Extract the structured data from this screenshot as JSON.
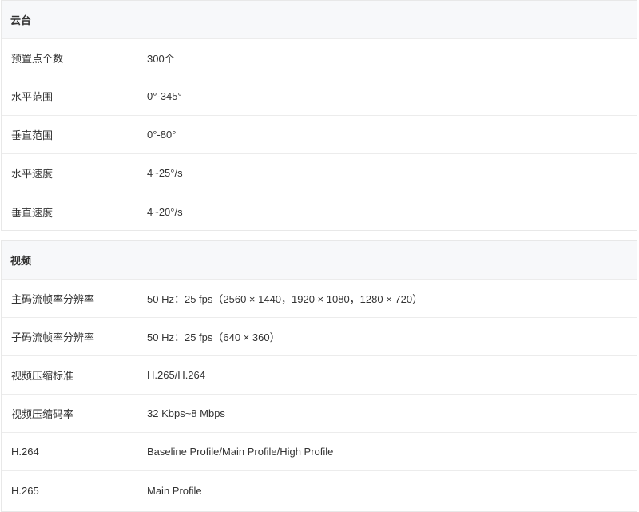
{
  "ptz": {
    "title": "云台",
    "rows": [
      {
        "key": "预置点个数",
        "value": "300个"
      },
      {
        "key": "水平范围",
        "value": "0°-345°"
      },
      {
        "key": "垂直范围",
        "value": "0°-80°"
      },
      {
        "key": "水平速度",
        "value": "4~25°/s"
      },
      {
        "key": "垂直速度",
        "value": "4~20°/s"
      }
    ]
  },
  "video": {
    "title": "视频",
    "rows": [
      {
        "key": "主码流帧率分辨率",
        "value": "50 Hz：25 fps（2560 × 1440，1920 × 1080，1280 × 720）"
      },
      {
        "key": "子码流帧率分辨率",
        "value": "50 Hz：25 fps（640 × 360）"
      },
      {
        "key": "视频压缩标准",
        "value": "H.265/H.264"
      },
      {
        "key": "视频压缩码率",
        "value": "32 Kbps~8 Mbps"
      },
      {
        "key": "H.264",
        "value": "Baseline Profile/Main Profile/High Profile"
      },
      {
        "key": "H.265",
        "value": "Main Profile"
      }
    ]
  }
}
